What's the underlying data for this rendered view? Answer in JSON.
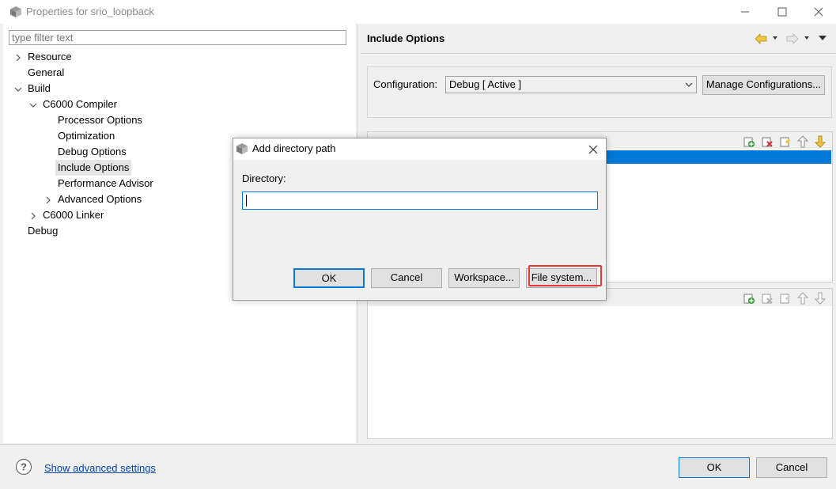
{
  "window": {
    "title": "Properties for srio_loopback"
  },
  "filter": {
    "placeholder": "type filter text"
  },
  "tree": {
    "resource": "Resource",
    "general": "General",
    "build": "Build",
    "c6000_compiler": "C6000 Compiler",
    "processor_options": "Processor Options",
    "optimization": "Optimization",
    "debug_options": "Debug Options",
    "include_options": "Include Options",
    "performance_advisor": "Performance Advisor",
    "advanced_options": "Advanced Options",
    "c6000_linker": "C6000 Linker",
    "debug": "Debug"
  },
  "right": {
    "section_title": "Include Options",
    "config_label": "Configuration:",
    "config_value": "Debug  [ Active ]",
    "manage_button": "Manage Configurations..."
  },
  "dialog": {
    "title": "Add directory path",
    "directory_label": "Directory:",
    "directory_value": "",
    "ok": "OK",
    "cancel": "Cancel",
    "workspace": "Workspace...",
    "file_system": "File system..."
  },
  "footer": {
    "advanced_link": "Show advanced settings",
    "ok": "OK",
    "cancel": "Cancel"
  },
  "colors": {
    "accent": "#0078d7",
    "highlight": "#e53935",
    "link": "#0645ad"
  }
}
